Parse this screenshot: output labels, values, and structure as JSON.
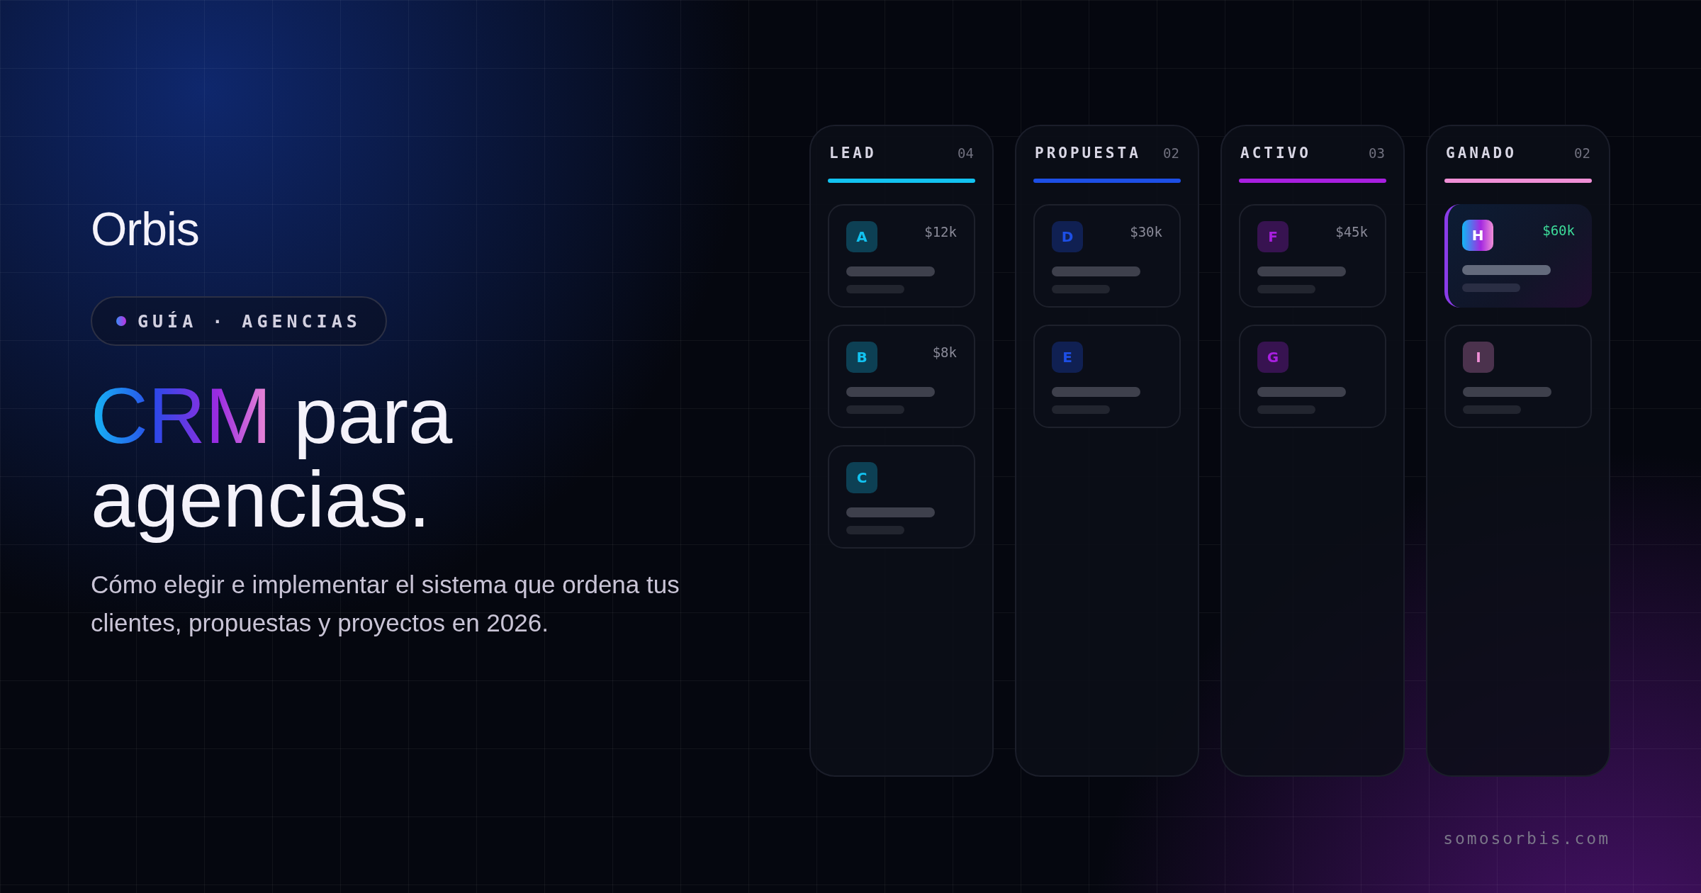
{
  "brand": {
    "logo": "Orbis"
  },
  "badge": {
    "text": "GUÍA · AGENCIAS"
  },
  "headline": [
    {
      "text": "CRM",
      "kind": "gradient"
    },
    {
      "text": " para agencias.",
      "kind": "plain"
    }
  ],
  "subtitle": "Cómo elegir e implementar el sistema que ordena tus clientes, propuestas y proyectos en 2026.",
  "board": {
    "columns": [
      {
        "name": "LEAD",
        "count": "04",
        "color": "#12c2f0",
        "cards": [
          {
            "kind": "normal",
            "initial": "A",
            "amount": "$12k"
          },
          {
            "kind": "normal",
            "initial": "B",
            "amount": "$8k"
          },
          {
            "kind": "normal",
            "initial": "C"
          }
        ]
      },
      {
        "name": "PROPUESTA",
        "count": "02",
        "color": "#1d4fe6",
        "cards": [
          {
            "kind": "normal",
            "initial": "D",
            "amount": "$30k"
          },
          {
            "kind": "normal",
            "initial": "E"
          }
        ]
      },
      {
        "name": "ACTIVO",
        "count": "03",
        "color": "#a81fe0",
        "cards": [
          {
            "kind": "normal",
            "initial": "F",
            "amount": "$45k"
          },
          {
            "kind": "normal",
            "initial": "G"
          }
        ]
      },
      {
        "name": "GANADO",
        "count": "02",
        "color": "#f08fd6",
        "cards": [
          {
            "kind": "featured",
            "initial": "H",
            "amount": "$60k"
          },
          {
            "kind": "normal",
            "initial": "I"
          }
        ]
      }
    ]
  },
  "footer": {
    "url": "somosorbis.com"
  }
}
